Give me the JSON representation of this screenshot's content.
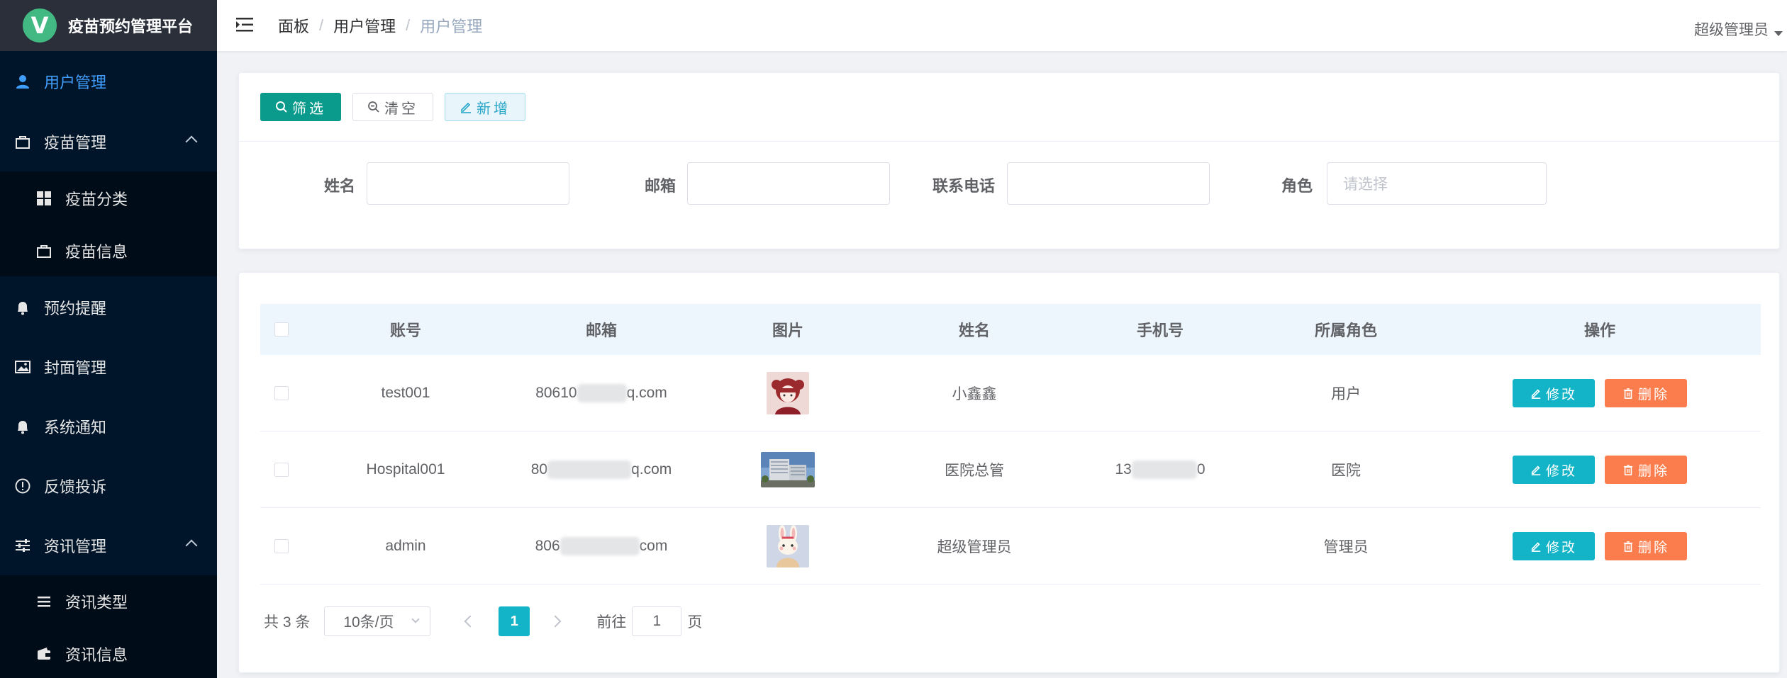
{
  "app": {
    "logo_letter": "V",
    "title": "疫苗预约管理平台"
  },
  "sidebar": {
    "items": [
      {
        "label": "用户管理",
        "icon": "user-icon",
        "active": true
      },
      {
        "label": "疫苗管理",
        "icon": "bag-icon",
        "expanded": true,
        "children": [
          {
            "label": "疫苗分类",
            "icon": "grid-icon"
          },
          {
            "label": "疫苗信息",
            "icon": "bag-icon"
          }
        ]
      },
      {
        "label": "预约提醒",
        "icon": "bell-icon"
      },
      {
        "label": "封面管理",
        "icon": "picture-icon"
      },
      {
        "label": "系统通知",
        "icon": "bell-icon"
      },
      {
        "label": "反馈投诉",
        "icon": "info-icon"
      },
      {
        "label": "资讯管理",
        "icon": "sliders-icon",
        "expanded": true,
        "children": [
          {
            "label": "资讯类型",
            "icon": "list-icon"
          },
          {
            "label": "资讯信息",
            "icon": "wallet-icon"
          }
        ]
      }
    ]
  },
  "header": {
    "breadcrumb": [
      "面板",
      "用户管理",
      "用户管理"
    ],
    "user_name": "超级管理员"
  },
  "toolbar": {
    "filter_label": "筛选",
    "clear_label": "清空",
    "add_label": "新增"
  },
  "search_form": {
    "name_label": "姓名",
    "email_label": "邮箱",
    "phone_label": "联系电话",
    "role_label": "角色",
    "role_placeholder": "请选择"
  },
  "table": {
    "columns": [
      "账号",
      "邮箱",
      "图片",
      "姓名",
      "手机号",
      "所属角色",
      "操作"
    ],
    "edit_label": "修改",
    "delete_label": "删除",
    "rows": [
      {
        "account": "test001",
        "email_visible_start": "80610",
        "email_visible_end": "q.com",
        "name": "小鑫鑫",
        "phone_visible_start": "",
        "phone_visible_end": "",
        "role": "用户",
        "image": "girl-avatar"
      },
      {
        "account": "Hospital001",
        "email_visible_start": "80",
        "email_visible_end": "q.com",
        "name": "医院总管",
        "phone_visible_start": "13",
        "phone_visible_end": "0",
        "role": "医院",
        "image": "hospital-photo"
      },
      {
        "account": "admin",
        "email_visible_start": "806",
        "email_visible_end": "com",
        "name": "超级管理员",
        "phone_visible_start": "",
        "phone_visible_end": "",
        "role": "管理员",
        "image": "bunny-avatar"
      }
    ]
  },
  "pagination": {
    "total_text": "共 3 条",
    "page_size": "10条/页",
    "current_page": "1",
    "goto_prefix": "前往",
    "goto_value": "1",
    "goto_suffix": "页"
  },
  "colors": {
    "sidebar_bg": "#001529",
    "active": "#409eff",
    "filter_btn": "#0a9b8c",
    "edit_btn": "#13b4c7",
    "delete_btn": "#fb7d4d"
  }
}
